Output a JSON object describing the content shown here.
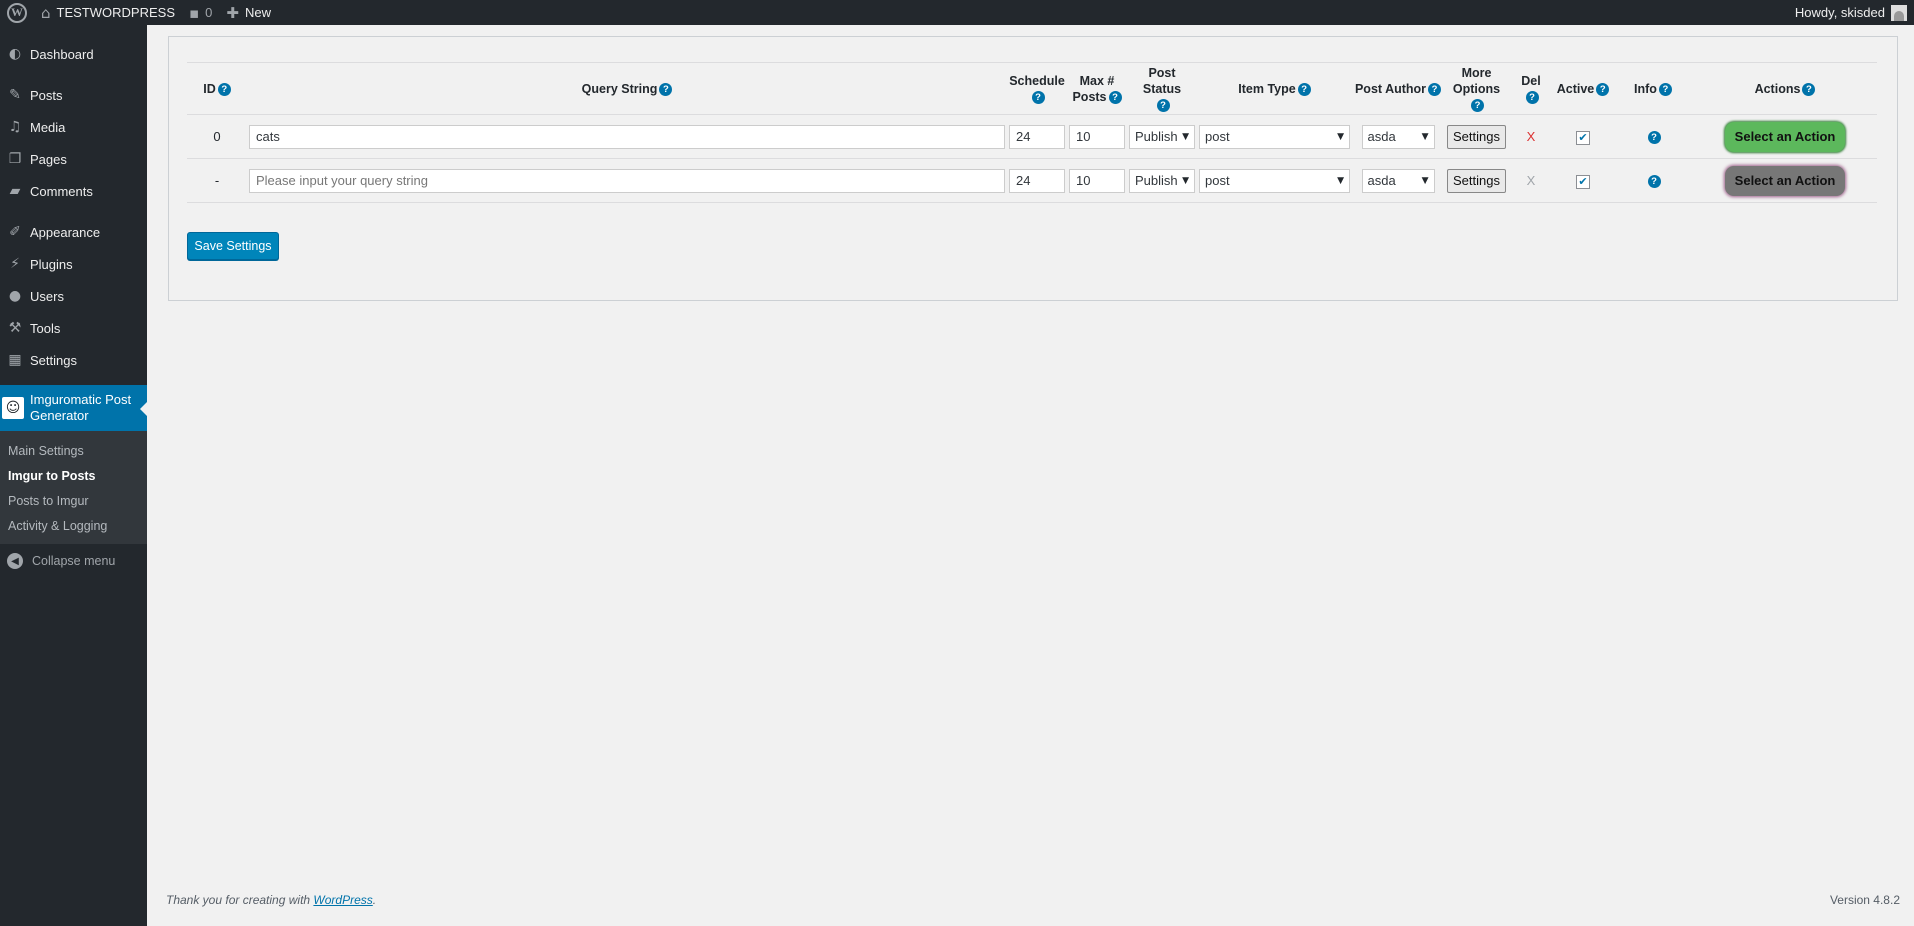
{
  "adminbar": {
    "site_name": "TESTWORDPRESS",
    "comments_count": "0",
    "new_label": "New",
    "greeting": "Howdy, skisded"
  },
  "sidebar": {
    "items": [
      {
        "label": "Dashboard",
        "icon": "dashboard-icon"
      },
      {
        "label": "Posts",
        "icon": "pin-icon"
      },
      {
        "label": "Media",
        "icon": "media-icon"
      },
      {
        "label": "Pages",
        "icon": "pages-icon"
      },
      {
        "label": "Comments",
        "icon": "comment-icon"
      },
      {
        "label": "Appearance",
        "icon": "brush-icon"
      },
      {
        "label": "Plugins",
        "icon": "plug-icon"
      },
      {
        "label": "Users",
        "icon": "user-icon"
      },
      {
        "label": "Tools",
        "icon": "wrench-icon"
      },
      {
        "label": "Settings",
        "icon": "settings-icon"
      }
    ],
    "current": {
      "label_line1": "Imguromatic Post",
      "label_line2": "Generator"
    },
    "submenu": [
      "Main Settings",
      "Imgur to Posts",
      "Posts to Imgur",
      "Activity & Logging"
    ],
    "collapse_label": "Collapse menu"
  },
  "table": {
    "headers": {
      "id": "ID",
      "query": "Query String",
      "schedule": "Schedule",
      "max_posts_1": "Max #",
      "max_posts_2": "Posts",
      "post_status": "Post Status",
      "item_type": "Item Type",
      "post_author": "Post Author",
      "more_options_1": "More",
      "more_options_2": "Options",
      "del": "Del",
      "active": "Active",
      "info": "Info",
      "actions": "Actions"
    },
    "help_glyph": "?",
    "rows": [
      {
        "id": "0",
        "query": "cats",
        "schedule": "24",
        "max_posts": "10",
        "post_status": "Publish",
        "item_type": "post",
        "post_author": "asda",
        "settings_label": "Settings",
        "del": "X",
        "active": true,
        "action_label": "Select an Action"
      },
      {
        "id": "-",
        "query_placeholder": "Please input your query string",
        "schedule": "24",
        "max_posts": "10",
        "post_status": "Publish",
        "item_type": "post",
        "post_author": "asda",
        "settings_label": "Settings",
        "del": "X",
        "active": true,
        "action_label": "Select an Action"
      }
    ]
  },
  "save_button": "Save Settings",
  "footer": {
    "thanks_prefix": "Thank you for creating with ",
    "thanks_link": "WordPress",
    "thanks_suffix": ".",
    "version": "Version 4.8.2"
  },
  "colors": {
    "admin_dark": "#23282d",
    "accent_blue": "#0073aa",
    "action_green": "#5cb85c",
    "action_gray": "#777777",
    "delete_red": "#dc3232"
  }
}
